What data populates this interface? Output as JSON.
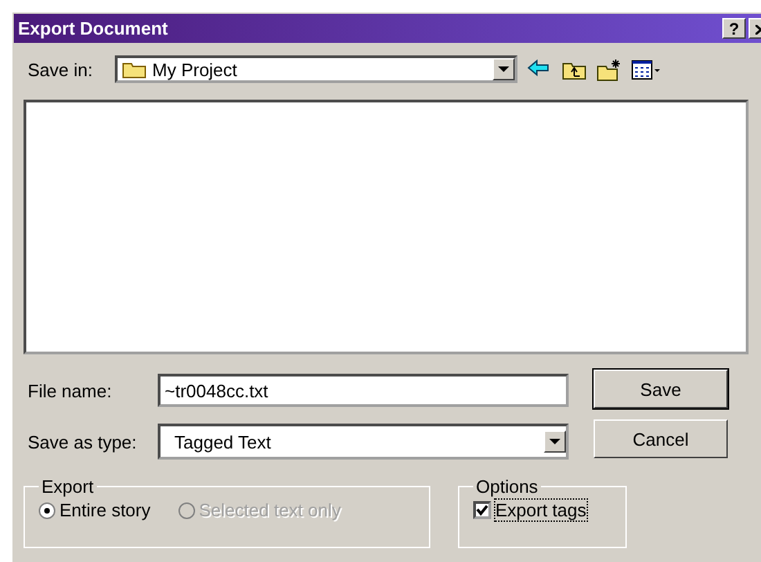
{
  "window": {
    "title": "Export Document",
    "help_button": "?"
  },
  "save_in": {
    "label": "Save in:",
    "value": "My Project"
  },
  "file_name": {
    "label": "File name:",
    "value": "~tr0048cc.txt"
  },
  "save_as_type": {
    "label": "Save as type:",
    "value": "Tagged Text"
  },
  "buttons": [
    {
      "label": "Save",
      "default": true
    },
    {
      "label": "Cancel",
      "default": false
    }
  ],
  "export_group": {
    "title": "Export",
    "options": [
      {
        "label": "Entire story",
        "selected": true,
        "disabled": false
      },
      {
        "label": "Selected text only",
        "selected": false,
        "disabled": true
      }
    ]
  },
  "options_group": {
    "title": "Options",
    "items": [
      {
        "label": "Export tags",
        "checked": true,
        "focused": true
      }
    ]
  }
}
